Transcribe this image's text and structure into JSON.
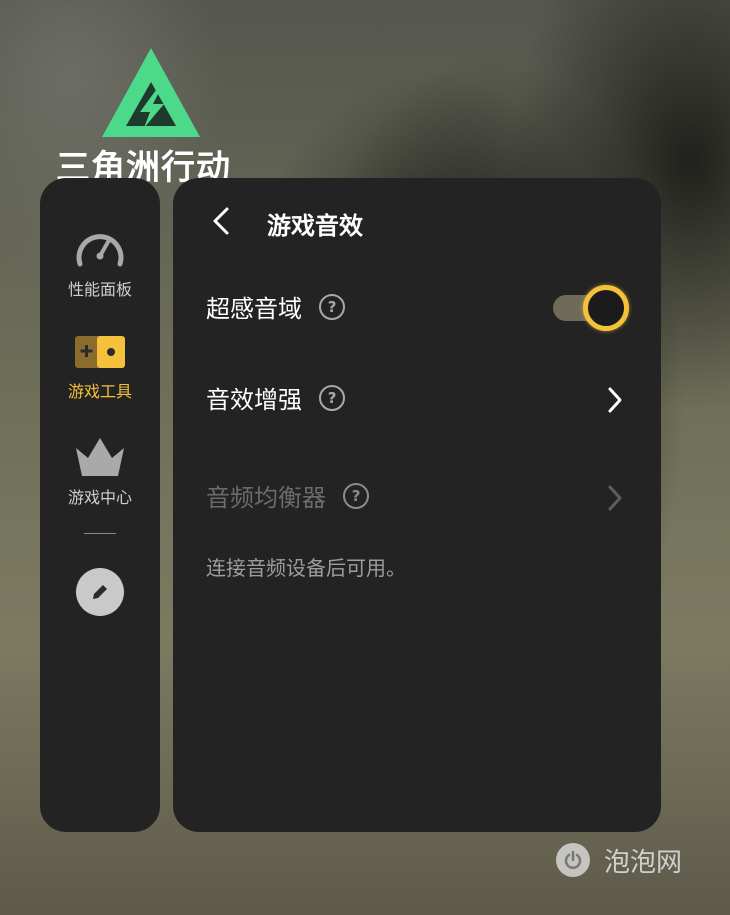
{
  "game_logo": {
    "text": "三角洲行动",
    "color": "#4cd98a"
  },
  "sidebar": {
    "items": [
      {
        "label": "性能面板",
        "icon": "speedometer-icon",
        "active": false
      },
      {
        "label": "游戏工具",
        "icon": "toolbox-icon",
        "active": true
      },
      {
        "label": "游戏中心",
        "icon": "crown-icon",
        "active": false
      }
    ],
    "edit_icon": "pencil-icon",
    "active_color": "#f5c13a"
  },
  "panel": {
    "title": "游戏音效",
    "settings": [
      {
        "label": "超感音域",
        "help": "?",
        "control": "toggle",
        "on": true,
        "enabled": true
      },
      {
        "label": "音效增强",
        "help": "?",
        "control": "chevron",
        "enabled": true
      },
      {
        "label": "音频均衡器",
        "help": "?",
        "control": "chevron",
        "enabled": false
      }
    ],
    "note": "连接音频设备后可用。"
  },
  "watermark": {
    "text": "泡泡网"
  }
}
